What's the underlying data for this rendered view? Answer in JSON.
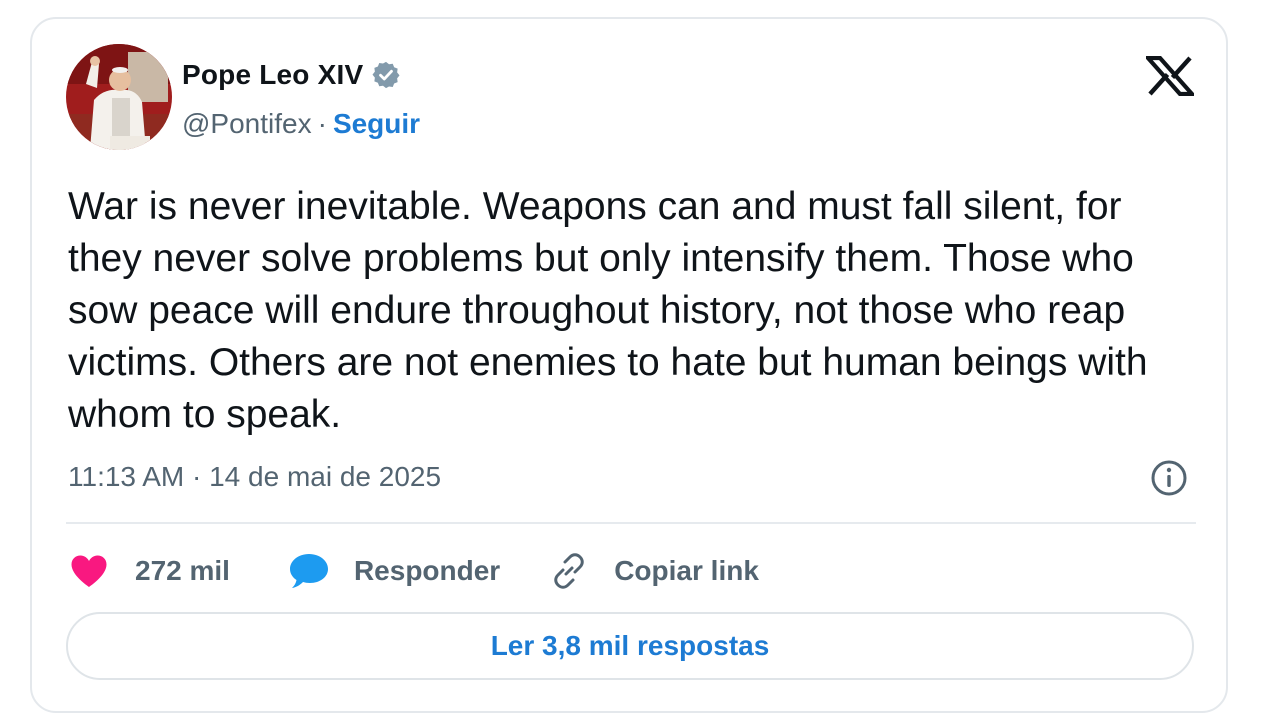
{
  "author": {
    "name": "Pope Leo XIV",
    "handle": "@Pontifex",
    "separator": "·",
    "follow_label": "Seguir",
    "avatar_icon": "person-photo",
    "verified_icon": "verified-badge-icon"
  },
  "tweet": {
    "text": "War is never inevitable. Weapons can and must fall silent, for they never solve problems but only intensify them. Those who sow peace will endure throughout history, not those who reap victims. Others are not enemies to hate but human beings with whom to speak.",
    "timestamp": "11:13 AM · 14 de mai de 2025"
  },
  "actions": {
    "like_count": "272 mil",
    "reply_label": "Responder",
    "copy_link_label": "Copiar link"
  },
  "footer": {
    "read_replies_label": "Ler 3,8 mil respostas"
  },
  "icons": {
    "brand": "x-logo-icon",
    "info": "info-icon",
    "like": "heart-icon",
    "reply": "speech-bubble-icon",
    "copy": "link-icon"
  },
  "colors": {
    "link_blue": "#1d7bd3",
    "heart_pink": "#f91880",
    "reply_blue": "#1d9bf0",
    "muted_text": "#536471",
    "border": "#e4e8ec"
  }
}
